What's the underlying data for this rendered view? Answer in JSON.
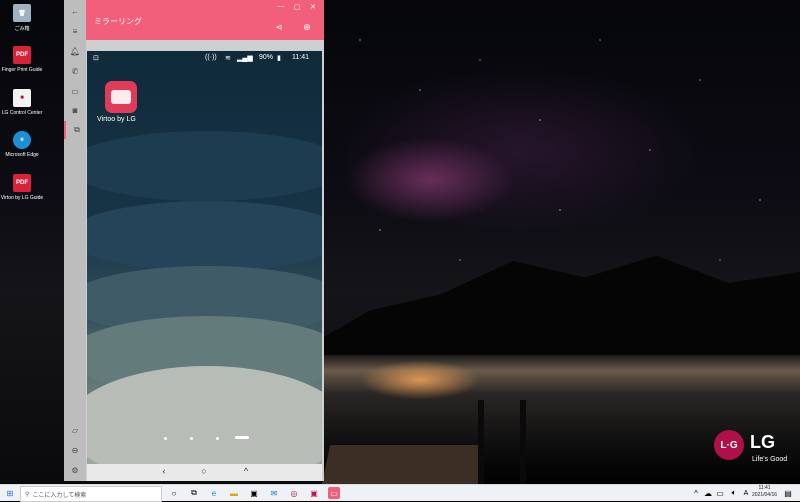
{
  "desktop": {
    "icons": [
      {
        "label": "ごみ箱",
        "icon": "recycle-bin-icon"
      },
      {
        "label": "Finger Print Guide",
        "icon": "pdf-icon"
      },
      {
        "label": "LG Control Center",
        "icon": "lg-control-center-icon"
      },
      {
        "label": "Microsoft Edge",
        "icon": "edge-icon"
      },
      {
        "label": "Virtoo by LG Guide",
        "icon": "pdf-icon"
      }
    ],
    "brand": {
      "logo": "LG",
      "tagline": "Life's Good"
    }
  },
  "window": {
    "title": "ミラーリング",
    "controls": {
      "minimize": "—",
      "maximize": "▢",
      "close": "✕"
    },
    "header_icons": [
      "share-icon",
      "globe-icon"
    ],
    "sidebar_icons": [
      "back-arrow-icon",
      "menu-icon",
      "notification-icon",
      "call-icon",
      "message-icon",
      "camera-icon",
      "mirroring-icon",
      "folder-icon",
      "minus-circle-icon",
      "settings-icon"
    ]
  },
  "phone": {
    "status": {
      "battery": "90%",
      "time": "11:41"
    },
    "home_app": {
      "label": "Virtoo by LG",
      "icon": "virtoo-icon"
    },
    "dock": [
      "chrome-icon",
      "apps-icon",
      "phone-icon",
      "camera-icon"
    ],
    "nav": {
      "back": "‹",
      "home": "○",
      "recents": "^"
    }
  },
  "taskbar": {
    "search_placeholder": "ここに入力して検索",
    "input_indicator": "A",
    "time": "11:41",
    "date": "2021/04/16",
    "colors": {
      "accent": "#f25f7b"
    }
  }
}
